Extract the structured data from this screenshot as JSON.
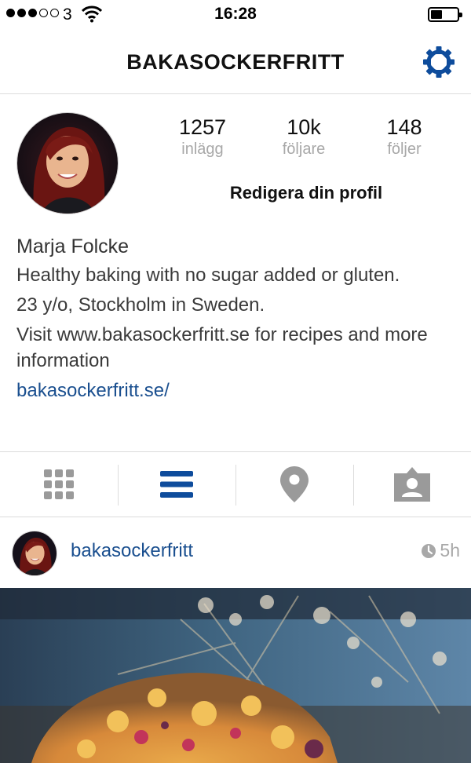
{
  "status_bar": {
    "carrier": "3",
    "time": "16:28",
    "signal_bars_filled": 3,
    "signal_bars_total": 5,
    "battery_level": 0.45
  },
  "header": {
    "title": "BAKASOCKERFRITT",
    "settings_icon": "gear-icon"
  },
  "profile": {
    "avatar_icon": "profile-photo",
    "stats": [
      {
        "value": "1257",
        "label": "inlägg"
      },
      {
        "value": "10k",
        "label": "följare"
      },
      {
        "value": "148",
        "label": "följer"
      }
    ],
    "edit_label": "Redigera din profil",
    "name": "Marja Folcke",
    "bio_lines": [
      "Healthy baking with no sugar added or gluten.",
      "23 y/o, Stockholm in Sweden.",
      "Visit www.bakasockerfritt.se for recipes and more information"
    ],
    "website": "bakasockerfritt.se/"
  },
  "tabs": [
    {
      "icon": "grid-icon",
      "active": false
    },
    {
      "icon": "list-icon",
      "active": true
    },
    {
      "icon": "location-pin-icon",
      "active": false
    },
    {
      "icon": "tagged-person-icon",
      "active": false
    }
  ],
  "post": {
    "username": "bakasockerfritt",
    "time": "5h",
    "time_icon": "clock-icon"
  },
  "colors": {
    "accent": "#0e4c9c",
    "link": "#1a4f8f",
    "inactive_icon": "#9a9a9a",
    "divider": "#dcdcdc",
    "muted_text": "#a8a8a8"
  }
}
